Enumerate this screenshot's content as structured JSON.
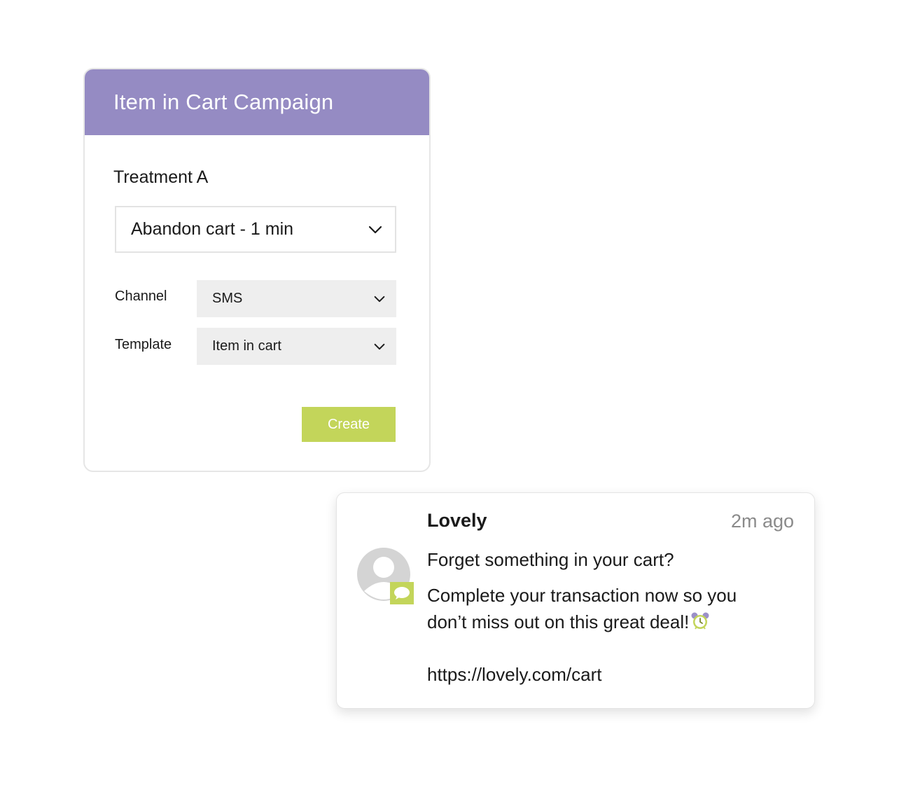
{
  "campaign": {
    "title": "Item in Cart Campaign",
    "treatment_label": "Treatment A",
    "trigger": {
      "value": "Abandon cart - 1 min"
    },
    "channel": {
      "label": "Channel",
      "value": "SMS"
    },
    "template": {
      "label": "Template",
      "value": "Item in cart"
    },
    "create_label": "Create"
  },
  "notification": {
    "sender": "Lovely",
    "timestamp": "2m ago",
    "headline": "Forget something in your cart?",
    "body_line1": "Complete your transaction now so you",
    "body_line2": "don’t miss out on this great deal!",
    "link": "https://lovely.com/cart",
    "icons": {
      "avatar": "user-avatar-icon",
      "badge": "chat-bubble-icon",
      "emoji": "alarm-clock-icon"
    }
  },
  "colors": {
    "header_purple": "#958bc3",
    "accent_green": "#c3d55a",
    "field_gray": "#eeeeee",
    "muted_text": "#8a8a8a"
  }
}
